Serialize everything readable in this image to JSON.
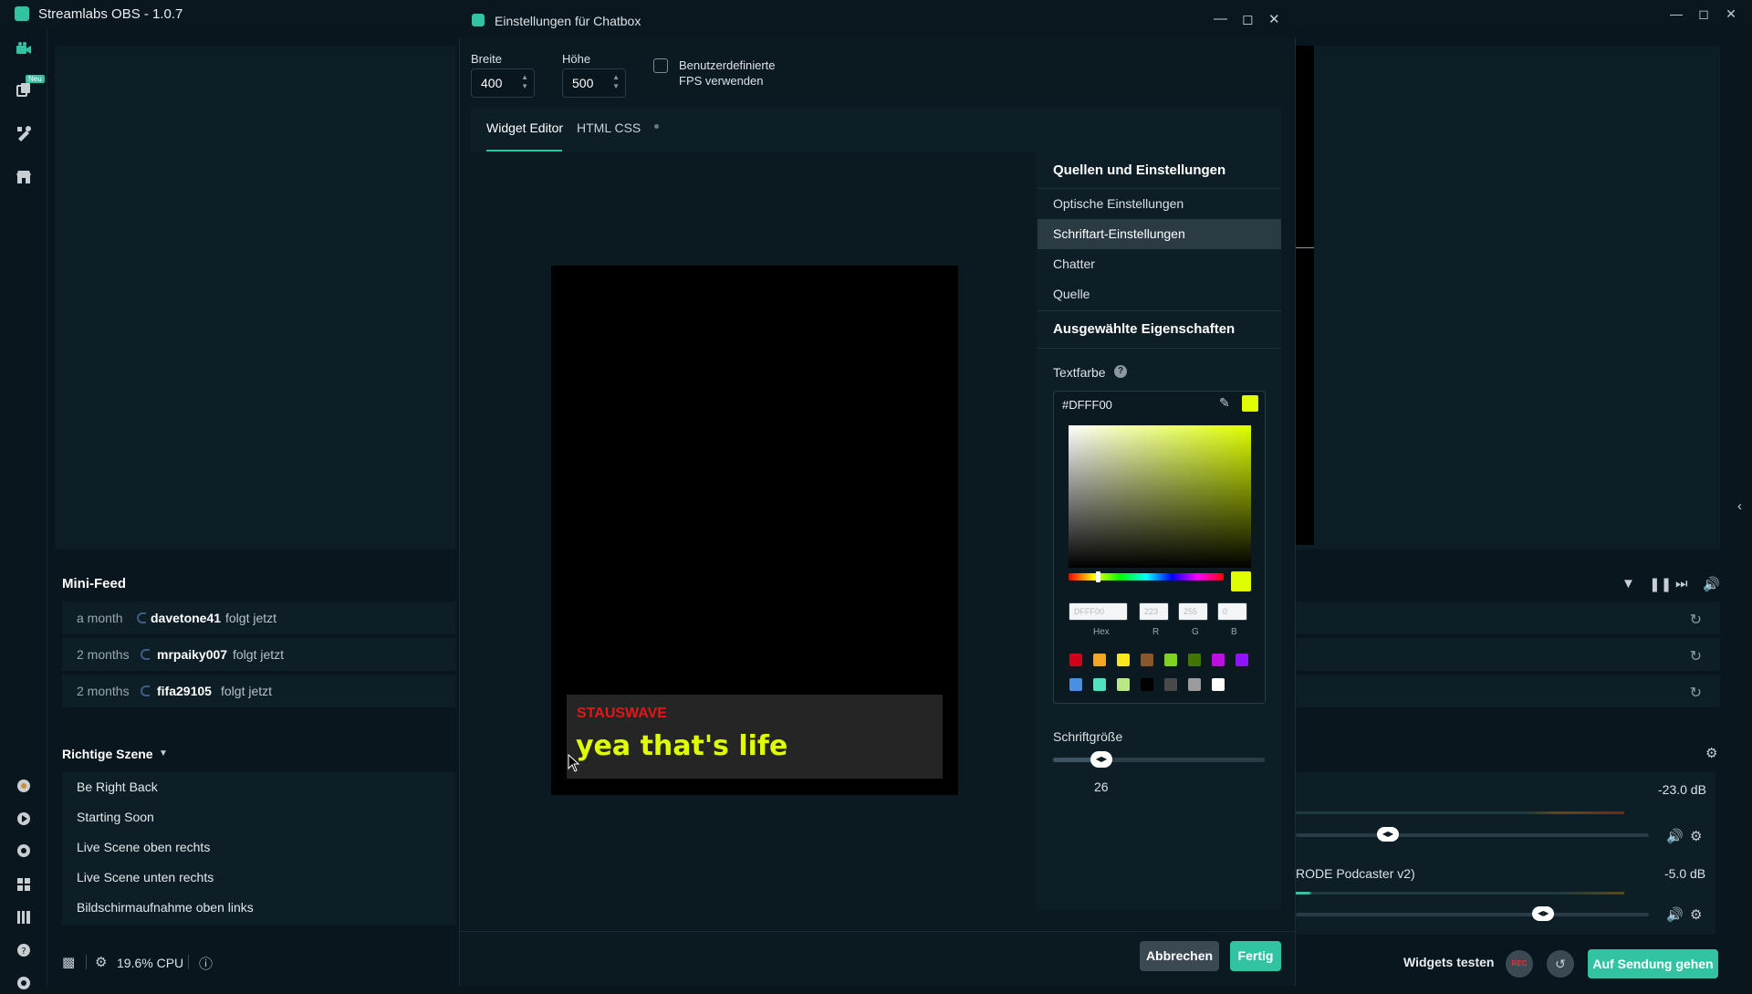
{
  "app": {
    "title": "Streamlabs OBS - 1.0.7",
    "new_badge": "Neu"
  },
  "modal": {
    "title": "Einstellungen für Chatbox",
    "width_label": "Breite",
    "width_value": "400",
    "height_label": "Höhe",
    "height_value": "500",
    "custom_fps_label": "Benutzerdefinierte FPS verwenden",
    "tabs": [
      {
        "label": "Widget Editor"
      },
      {
        "label": "HTML CSS"
      }
    ],
    "chat_preview": {
      "name": "STAUSWAVE",
      "message": "yea that's life"
    },
    "sections": {
      "sources_title": "Quellen und Einstellungen",
      "menu": [
        "Optische Einstellungen",
        "Schriftart-Einstellungen",
        "Chatter",
        "Quelle"
      ],
      "selected_title": "Ausgewählte Eigenschaften",
      "text_color_label": "Textfarbe",
      "font_size_label": "Schriftgröße"
    },
    "picker": {
      "hex": "#DFFF00",
      "hex_placeholder": "DFFF00",
      "r": "223",
      "g": "255",
      "b": "0",
      "labels": {
        "hex": "Hex",
        "r": "R",
        "g": "G",
        "b": "B"
      },
      "presets": [
        "#d0021b",
        "#f5a623",
        "#f8e71c",
        "#8b572a",
        "#7ed321",
        "#417505",
        "#bd10e0",
        "#9013fe",
        "#4a90e2",
        "#50e3c2",
        "#b8e986",
        "#000000",
        "#4a4a4a",
        "#9b9b9b",
        "#ffffff"
      ]
    },
    "font_size_value": "26",
    "buttons": {
      "cancel": "Abbrechen",
      "done": "Fertig"
    }
  },
  "minifeed": {
    "title": "Mini-Feed",
    "rows": [
      {
        "time": "a month",
        "user": "davetone41",
        "action": "folgt jetzt"
      },
      {
        "time": "2 months",
        "user": "mrpaiky007",
        "action": "folgt jetzt"
      },
      {
        "time": "2 months",
        "user": "fifa29105",
        "action": "folgt jetzt"
      }
    ]
  },
  "scenes": {
    "title": "Richtige Szene",
    "items": [
      "Be Right Back",
      "Starting Soon",
      "Live Scene oben rechts",
      "Live Scene unten rechts",
      "Bildschirmaufnahme oben links"
    ]
  },
  "status": {
    "cpu": "19.6% CPU"
  },
  "mixer": {
    "channel1_db": "-23.0 dB",
    "channel1_level": 0.23,
    "channel2_name": "RODE Podcaster v2)",
    "channel2_db": "-5.0 dB",
    "channel2_level": 0.67
  },
  "footer": {
    "widgets_test": "Widgets testen",
    "rec": "REC",
    "go_live": "Auf Sendung gehen"
  },
  "colors": {
    "accent": "#31c3a2",
    "text_color": "#dfff00",
    "chat_name": "#e01818"
  }
}
